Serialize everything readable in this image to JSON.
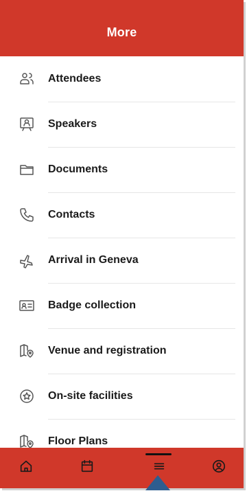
{
  "header": {
    "title": "More"
  },
  "menu": {
    "items": [
      {
        "label": "Attendees",
        "icon": "people-icon"
      },
      {
        "label": "Speakers",
        "icon": "speaker-podium-icon"
      },
      {
        "label": "Documents",
        "icon": "folder-icon"
      },
      {
        "label": "Contacts",
        "icon": "phone-icon"
      },
      {
        "label": "Arrival in Geneva",
        "icon": "airplane-icon"
      },
      {
        "label": "Badge collection",
        "icon": "badge-id-icon"
      },
      {
        "label": "Venue and registration",
        "icon": "map-pin-icon"
      },
      {
        "label": "On-site facilities",
        "icon": "star-circle-icon"
      },
      {
        "label": "Floor Plans",
        "icon": "map-pin-icon"
      }
    ]
  },
  "tabbar": {
    "tabs": [
      {
        "icon": "home-icon",
        "active": false
      },
      {
        "icon": "calendar-icon",
        "active": false
      },
      {
        "icon": "menu-icon",
        "active": true
      },
      {
        "icon": "profile-icon",
        "active": false
      }
    ]
  },
  "colors": {
    "accent": "#d0382a",
    "pointer": "#2d5d8f"
  }
}
